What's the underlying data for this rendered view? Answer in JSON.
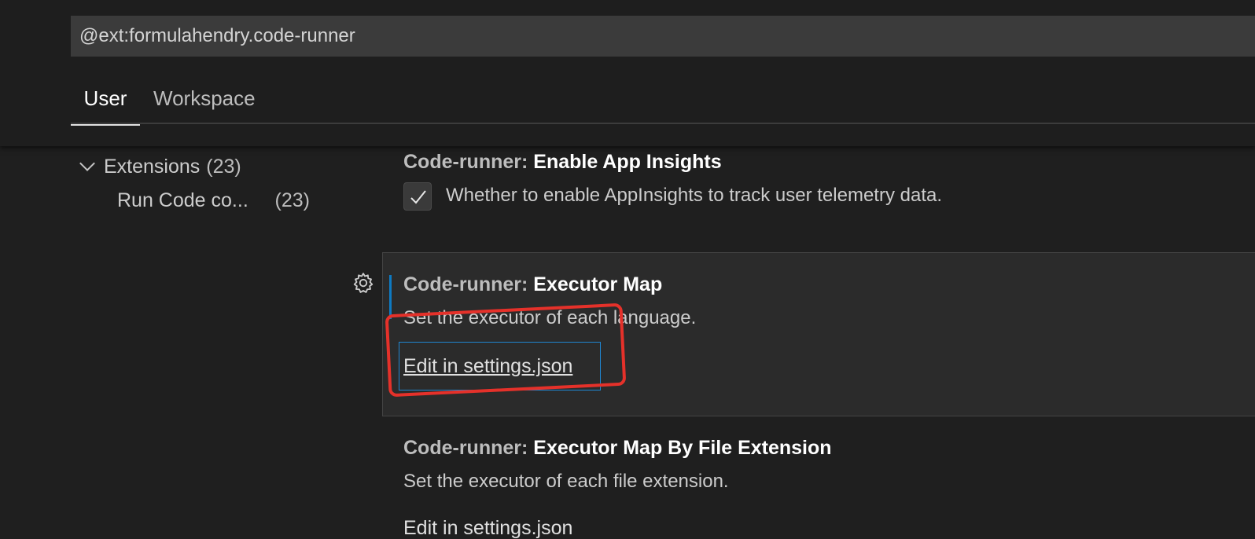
{
  "search": {
    "value": "@ext:formulahendry.code-runner"
  },
  "tabs": [
    {
      "label": "User",
      "active": true
    },
    {
      "label": "Workspace",
      "active": false
    }
  ],
  "toc": {
    "group_label": "Extensions",
    "group_count": "(23)",
    "items": [
      {
        "label": "Run Code co...",
        "count": "(23)"
      }
    ]
  },
  "settings": [
    {
      "category": "Code-runner: ",
      "name": "Enable App Insights",
      "description": "Whether to enable AppInsights to track user telemetry data.",
      "checked": true
    },
    {
      "category": "Code-runner: ",
      "name": "Executor Map",
      "description": "Set the executor of each language.",
      "link": "Edit in settings.json"
    },
    {
      "category": "Code-runner: ",
      "name": "Executor Map By File Extension",
      "description": "Set the executor of each file extension.",
      "link": "Edit in settings.json"
    }
  ],
  "colors": {
    "accent": "#0e7ac2",
    "annotation": "#e5312a",
    "background": "#1f1f1f"
  },
  "icons": {
    "toc_chevron": "chevron-down-icon",
    "checkbox": "check-icon",
    "setting_gear": "gear-icon"
  }
}
